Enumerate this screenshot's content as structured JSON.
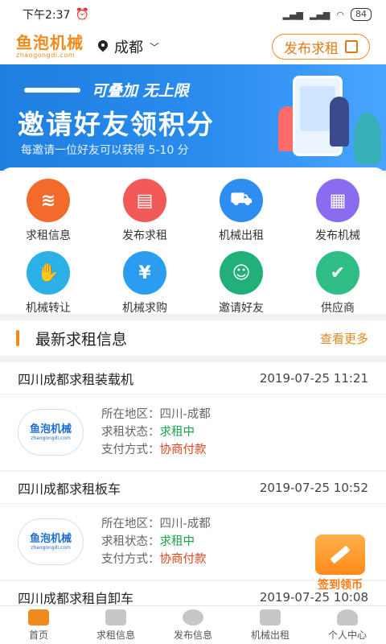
{
  "status_bar": {
    "time": "下午2:37",
    "battery": "84"
  },
  "header": {
    "logo_cn": "鱼泡机械",
    "logo_en": "zhaogongdi.com",
    "city": "成都",
    "post_button": "发布求租"
  },
  "banner": {
    "line1": "可叠加  无上限",
    "line2": "邀请好友领积分",
    "line3": "每邀请一位好友可以获得 5-10 分"
  },
  "grid": {
    "items": [
      {
        "label": "求租信息",
        "icon": "layers-icon",
        "color": "#f26b2b"
      },
      {
        "label": "发布求租",
        "icon": "document-icon",
        "color": "#f25a5a"
      },
      {
        "label": "机械出租",
        "icon": "excavator-icon",
        "color": "#2e8df0"
      },
      {
        "label": "发布机械",
        "icon": "clipboard-icon",
        "color": "#8a6cf0"
      },
      {
        "label": "机械转让",
        "icon": "handshake-icon",
        "color": "#2bb0e8"
      },
      {
        "label": "机械求购",
        "icon": "yuan-bill-icon",
        "color": "#2b9df0"
      },
      {
        "label": "邀请好友",
        "icon": "add-user-icon",
        "color": "#22b07a"
      },
      {
        "label": "供应商",
        "icon": "supplier-icon",
        "color": "#2ebd85"
      }
    ]
  },
  "news": {
    "title": "最新求租信息",
    "more": "查看更多"
  },
  "listings": [
    {
      "name": "四川成都求租装载机",
      "date": "2019-07-25 11:21",
      "region_label": "所在地区：",
      "region": "四川-成都",
      "status_label": "求租状态：",
      "status": "求租中",
      "pay_label": "支付方式：",
      "pay": "协商付款"
    },
    {
      "name": "四川成都求租板车",
      "date": "2019-07-25 10:52",
      "region_label": "所在地区：",
      "region": "四川-成都",
      "status_label": "求租状态：",
      "status": "求租中",
      "pay_label": "支付方式：",
      "pay": "协商付款"
    },
    {
      "name": "四川成都求租自卸车",
      "date": "2019-07-25 10:08"
    }
  ],
  "sign_in": "签到领币",
  "tabbar": [
    {
      "label": "首页",
      "icon": "home-icon"
    },
    {
      "label": "求租信息",
      "icon": "list-icon"
    },
    {
      "label": "发布信息",
      "icon": "plus-circle-icon"
    },
    {
      "label": "机械出租",
      "icon": "machine-icon"
    },
    {
      "label": "个人中心",
      "icon": "user-icon"
    }
  ]
}
